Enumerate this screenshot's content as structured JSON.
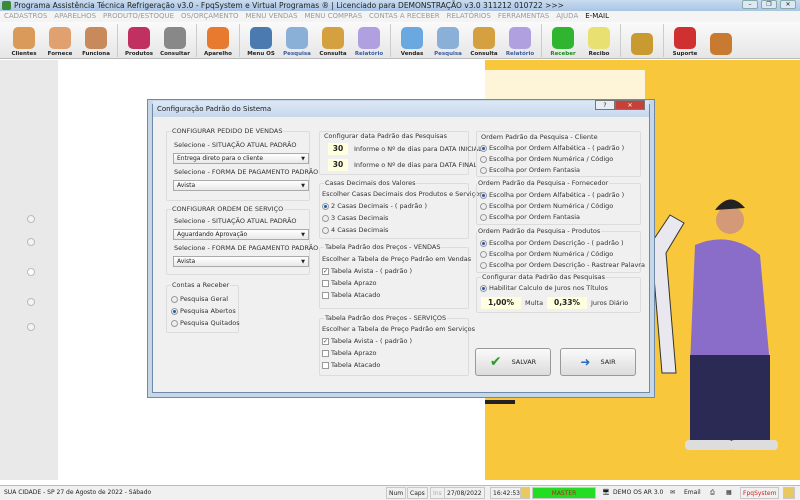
{
  "window": {
    "title": "Programa Assistência Técnica Refrigeração v3.0 - FpqSystem e Virtual Programas ® | Licenciado para  DEMONSTRAÇÃO v3.0 311212 010722 >>>"
  },
  "menu": [
    "CADASTROS",
    "APARELHOS",
    "PRODUTO/ESTOQUE",
    "OS/ORÇAMENTO",
    "MENU VENDAS",
    "MENU COMPRAS",
    "CONTAS A RECEBER",
    "RELATÓRIOS",
    "FERRAMENTAS",
    "AJUDA",
    "E-MAIL"
  ],
  "toolbar": [
    {
      "label": "Clientes",
      "icon": "clients-icon",
      "color": "#d99a5a"
    },
    {
      "label": "Fornece",
      "icon": "supplier-icon",
      "color": "#e0a070"
    },
    {
      "label": "Funciona",
      "icon": "employees-icon",
      "color": "#c88a5a"
    },
    {
      "label": "Produtos",
      "icon": "products-icon",
      "color": "#c03060"
    },
    {
      "label": "Consultar",
      "icon": "barcode-icon",
      "color": "#888"
    },
    {
      "label": "Aparelho",
      "icon": "aparelho-icon",
      "color": "#e87a30"
    },
    {
      "label": "Menu OS",
      "icon": "tools-icon",
      "color": "#4a7ab0"
    },
    {
      "label": "Pesquisa",
      "icon": "search-doc-icon",
      "color": "#8ab0d8"
    },
    {
      "label": "Consulta",
      "icon": "drawer-icon",
      "color": "#d4a040"
    },
    {
      "label": "Relatório",
      "icon": "printer-icon",
      "color": "#b0a0e0"
    },
    {
      "label": "Vendas",
      "icon": "monitor-icon",
      "color": "#6aa8e0"
    },
    {
      "label": "Pesquisa",
      "icon": "search-doc-icon",
      "color": "#8ab0d8"
    },
    {
      "label": "Consulta",
      "icon": "drawer-icon",
      "color": "#d4a040"
    },
    {
      "label": "Relatório",
      "icon": "printer-icon",
      "color": "#b0a0e0"
    },
    {
      "label": "Receber",
      "icon": "dollar-icon",
      "color": "#2fb52f"
    },
    {
      "label": "Recibo",
      "icon": "receipt-icon",
      "color": "#e8e070"
    },
    {
      "label": "",
      "icon": "coins-icon",
      "color": "#c89a30"
    },
    {
      "label": "Suporte",
      "icon": "support-icon",
      "color": "#d03030"
    },
    {
      "label": "",
      "icon": "exit-door-icon",
      "color": "#c87a30"
    }
  ],
  "dialog": {
    "title": "Configuração Padrão do Sistema",
    "vendas": {
      "title": "CONFIGURAR PEDIDO DE VENDAS",
      "sit_label": "Selecione - SITUAÇÃO ATUAL PADRÃO",
      "sit_value": "Entrega direto para o cliente",
      "pag_label": "Selecione - FORMA DE PAGAMENTO PADRÃO",
      "pag_value": "Avista"
    },
    "os": {
      "title": "CONFIGURAR ORDEM DE SERVIÇO",
      "sit_label": "Selecione - SITUAÇÃO ATUAL PADRÃO",
      "sit_value": "Aguardando Aprovação",
      "pag_label": "Selecione - FORMA DE PAGAMENTO PADRÃO",
      "pag_value": "Avista"
    },
    "contas": {
      "title": "Contas a Receber",
      "options": [
        "Pesquisa Geral",
        "Pesquisa Abertos",
        "Pesquisa Quitados"
      ],
      "selected": 1
    },
    "datas": {
      "title": "Configurar data Padrão das Pesquisas",
      "inicial": "30",
      "inicial_label": "Informe o Nº de dias para DATA INICIAL",
      "final": "30",
      "final_label": "Informe o Nº de dias para DATA FINAL"
    },
    "casas": {
      "title": "Casas Decimais dos Valores",
      "subtitle": "Escolher Casas Decimais dos Produtos e Serviços",
      "options": [
        "2 Casas Decimais - ( padrão )",
        "3 Casas Decimais",
        "4 Casas Decimais"
      ],
      "selected": 0
    },
    "tab_vendas": {
      "title": "Tabela Padrão dos Preços - VENDAS",
      "subtitle": "Escolher a Tabela de Preço Padrão em Vendas",
      "options": [
        "Tabela Avista - ( padrão )",
        "Tabela Aprazo",
        "Tabela Atacado"
      ],
      "checked": [
        true,
        false,
        false
      ]
    },
    "tab_servicos": {
      "title": "Tabela Padrão dos Preços - SERVIÇOS",
      "subtitle": "Escolher a Tabela de Preço Padrão em Serviços",
      "options": [
        "Tabela Avista - ( padrão )",
        "Tabela Aprazo",
        "Tabela Atacado"
      ],
      "checked": [
        true,
        false,
        false
      ]
    },
    "cliente": {
      "title": "Ordem Padrão da Pesquisa - Cliente",
      "options": [
        "Escolha por Ordem Alfabética - ( padrão )",
        "Escolha por Ordem Numérica / Código",
        "Escolha por Ordem Fantasia"
      ],
      "selected": 0
    },
    "fornecedor": {
      "title": "Ordem Padrão da Pesquisa - Fornecedor",
      "options": [
        "Escolha por Ordem Alfabética - ( padrão )",
        "Escolha por Ordem Numérica / Código",
        "Escolha por Ordem Fantasia"
      ],
      "selected": 0
    },
    "produtos": {
      "title": "Ordem Padrão da Pesquisa - Produtos",
      "options": [
        "Escolha por Ordem Descrição - ( padrão )",
        "Escolha por Ordem Numérica / Código",
        "Escolha por Ordem Descrição - Rastrear Palavra"
      ],
      "selected": 0
    },
    "juros": {
      "title": "Configurar data Padrão das Pesquisas",
      "enable": "Habilitar Calculo de Juros nos Títulos",
      "multa": "1,00%",
      "multa_label": "Multa",
      "juros": "0,33%",
      "juros_label": "Juros Diário"
    },
    "salvar": "SALVAR",
    "sair": "SAIR"
  },
  "status": {
    "city": "SUA CIDADE - SP 27 de Agosto de 2022 - Sábado",
    "num": "Num",
    "caps": "Caps",
    "ins": "Ins",
    "date": "27/08/2022",
    "time": "16:42:53",
    "user": "MASTER",
    "version": "DEMO OS AR 3.0",
    "email": "Email",
    "brand": "FpqSystem"
  }
}
